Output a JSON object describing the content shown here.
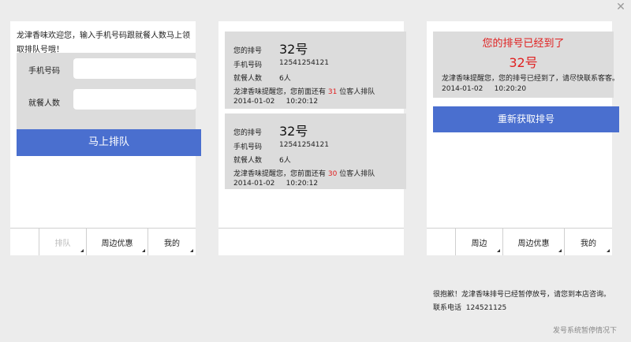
{
  "close_symbol": "✕",
  "panel1": {
    "welcome": "龙津香味欢迎您，输入手机号码跟就餐人数马上领取排队号哦！",
    "phone_label": "手机号码",
    "phone_value": "",
    "diners_label": "就餐人数",
    "diners_value": "",
    "queue_button": "马上排队",
    "nav": [
      "",
      "排队",
      "周边优惠",
      "我的"
    ]
  },
  "panel2": {
    "tickets": [
      {
        "queue_label": "您的排号",
        "queue_number": "32号",
        "phone_label": "手机号码",
        "phone": "12541254121",
        "diners_label": "就餐人数",
        "diners": "6人",
        "msg_prefix": "龙津香味提醒您，您前面还有",
        "ahead": "31",
        "msg_suffix": "位客人排队",
        "date": "2014-01-02",
        "time": "10:20:12"
      },
      {
        "queue_label": "您的排号",
        "queue_number": "32号",
        "phone_label": "手机号码",
        "phone": "12541254121",
        "diners_label": "就餐人数",
        "diners": "6人",
        "msg_prefix": "龙津香味提醒您，您前面还有",
        "ahead": "30",
        "msg_suffix": "位客人排队",
        "date": "2014-01-02",
        "time": "10:20:12"
      }
    ]
  },
  "panel3": {
    "title": "您的排号已经到了",
    "number": "32号",
    "message": "龙津香味提醒您，您的排号已经到了，请尽快联系客客。",
    "date": "2014-01-02",
    "time": "10:20:20",
    "refresh_button": "重新获取排号",
    "nav": [
      "",
      "周边",
      "周边优惠",
      "我的"
    ]
  },
  "notice": {
    "line1": "很抱歉！龙津香味排号已经暂停放号，请您到本店咨询。",
    "phone_label": "联系电话",
    "phone": "124521125"
  },
  "footer_note": "发号系统暂停情况下"
}
